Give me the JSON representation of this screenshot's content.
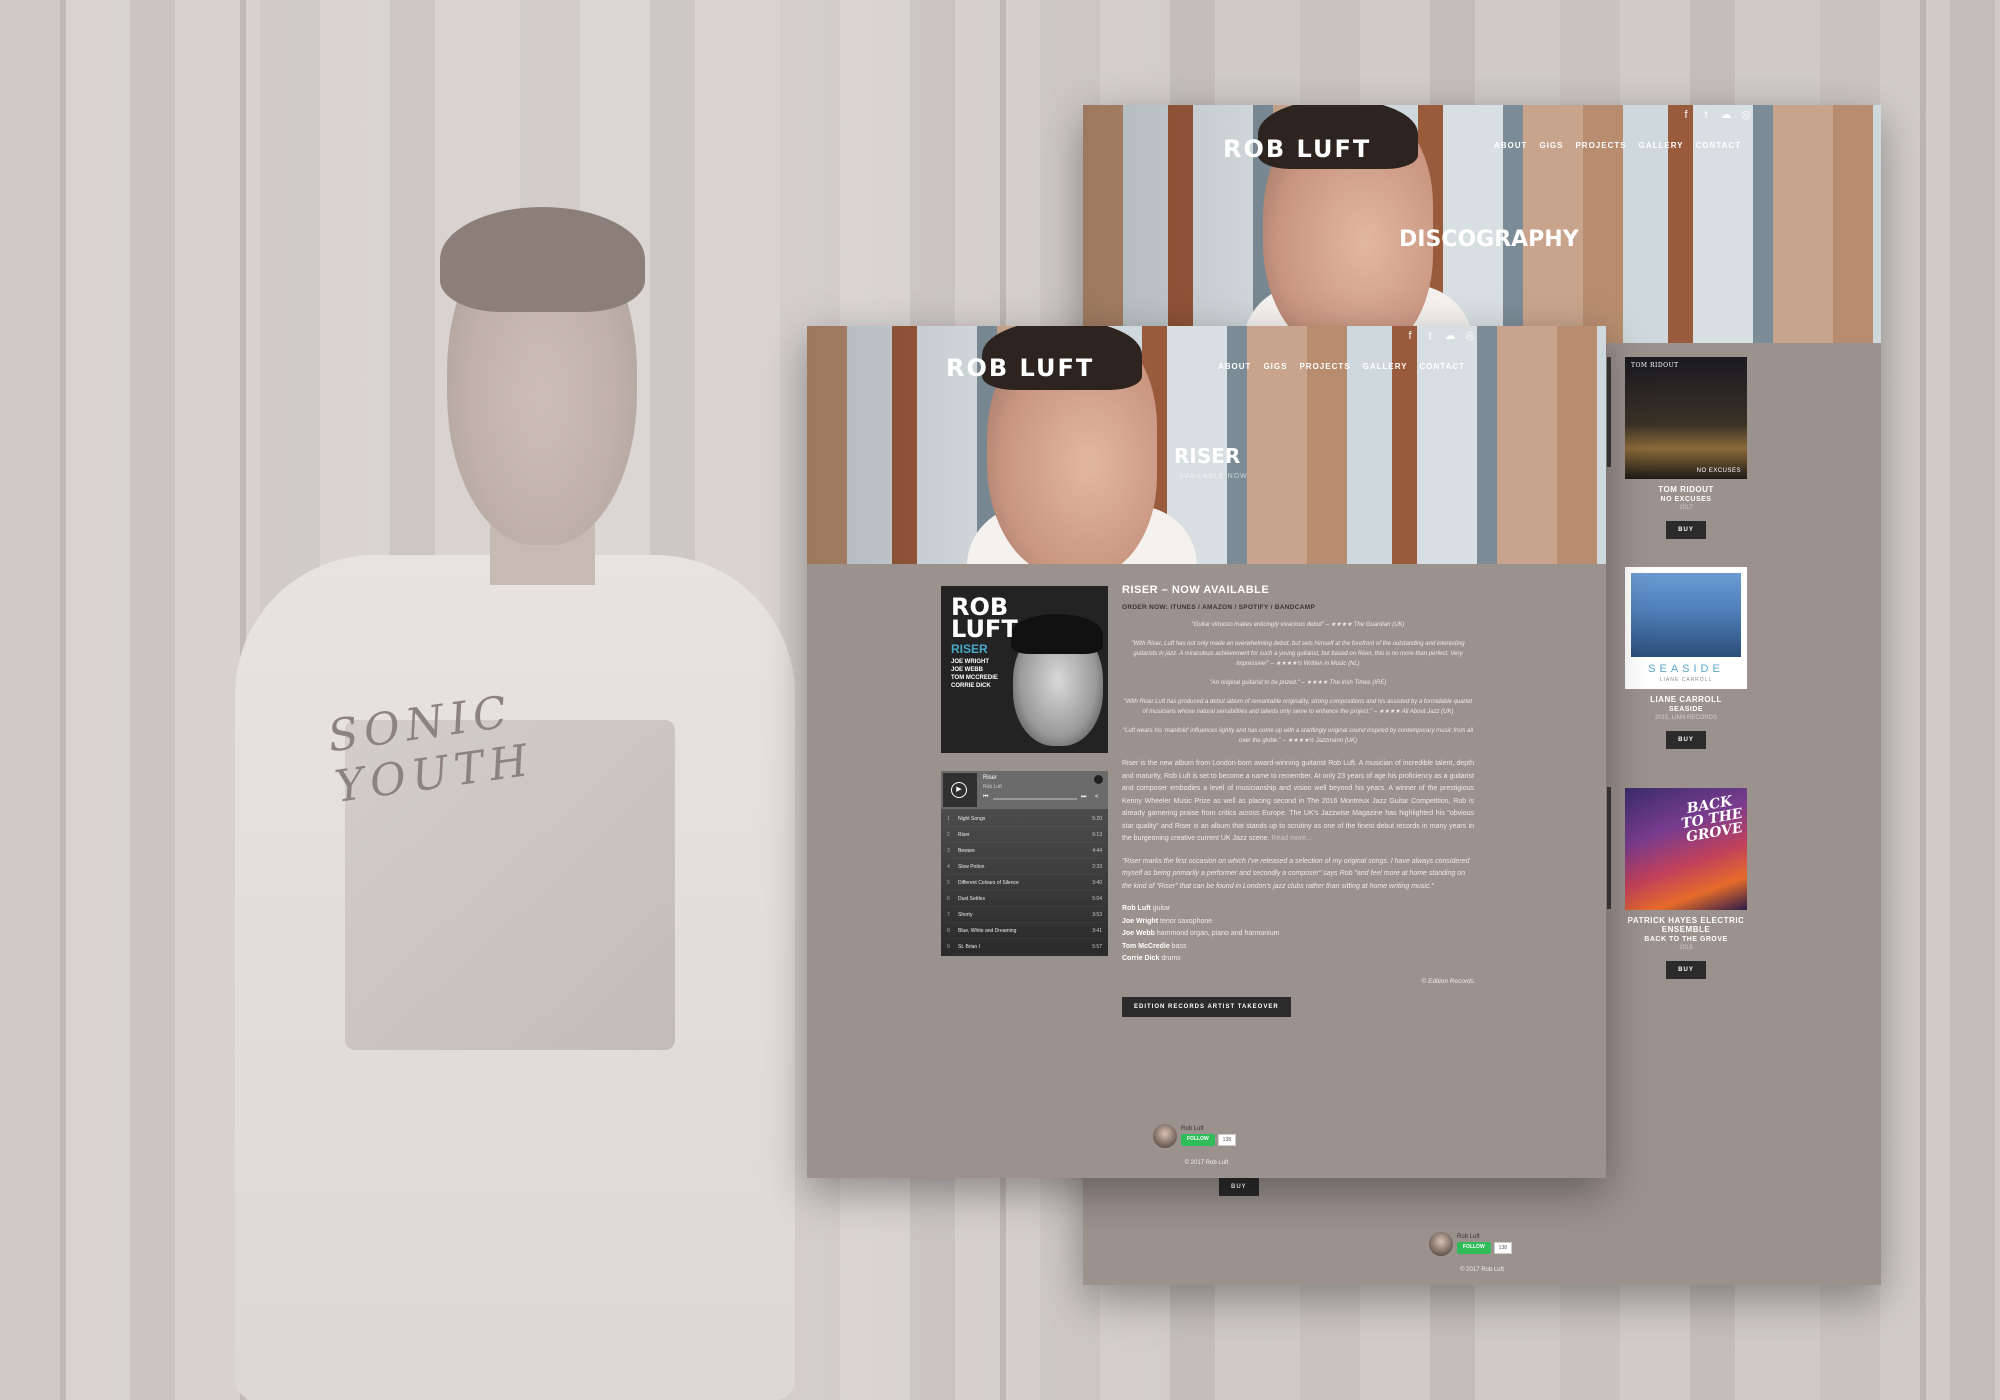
{
  "back_window": {
    "logo": "ROB LUFT",
    "nav": [
      "ABOUT",
      "GIGS",
      "PROJECTS",
      "GALLERY",
      "CONTACT"
    ],
    "social_icons": [
      "facebook-icon",
      "twitter-icon",
      "soundcloud-icon",
      "instagram-icon"
    ],
    "hero_title": "DISCOGRAPHY",
    "discs": [
      {
        "cover_text_top": "TOM RIDOUT",
        "cover_text_bottom": "NO EXCUSES",
        "artist": "TOM RIDOUT",
        "album": "NO EXCUSES",
        "meta": "2017",
        "buy": "BUY"
      },
      {
        "cover_text_top": "SEASIDE",
        "cover_text_bottom": "LIANE CARROLL",
        "artist": "LIANE CARROLL",
        "album": "SEASIDE",
        "meta": "2015, LINN RECORDS",
        "buy": "BUY"
      },
      {
        "cover_text_top": "BACK TO THE GROVE",
        "cover_text_bottom": "",
        "artist": "PATRICK HAYES ELECTRIC ENSEMBLE",
        "album": "BACK TO THE GROVE",
        "meta": "2015",
        "buy": "BUY"
      }
    ],
    "lower_buy": "BUY",
    "follow": {
      "name": "Rob Luft",
      "button": "FOLLOW",
      "count": "138"
    },
    "copyright": "© 2017 Rob Luft"
  },
  "front_window": {
    "logo": "ROB LUFT",
    "nav": [
      "ABOUT",
      "GIGS",
      "PROJECTS",
      "GALLERY",
      "CONTACT"
    ],
    "social_icons": [
      "facebook-icon",
      "twitter-icon",
      "soundcloud-icon",
      "instagram-icon"
    ],
    "hero_title": "RISER",
    "hero_sub": "AVAILABLE NOW",
    "album_art": {
      "title": "ROB\nLUFT",
      "album": "RISER",
      "names": "JOE WRIGHT\nJOE WEBB\nTOM MCCREDIE\nCORRIE DICK"
    },
    "player": {
      "title": "Riser",
      "artist": "Rob Luft",
      "tracks": [
        {
          "n": "1",
          "t": "Night Songs",
          "d": "5:20"
        },
        {
          "n": "2",
          "t": "Riser",
          "d": "6:13"
        },
        {
          "n": "3",
          "t": "Beware",
          "d": "4:44"
        },
        {
          "n": "4",
          "t": "Slow Potion",
          "d": "2:33"
        },
        {
          "n": "5",
          "t": "Different Colours of Silence",
          "d": "3:40"
        },
        {
          "n": "6",
          "t": "Dust Settles",
          "d": "5:04"
        },
        {
          "n": "7",
          "t": "Shorty",
          "d": "3:53"
        },
        {
          "n": "8",
          "t": "Blue, White and Dreaming",
          "d": "3:41"
        },
        {
          "n": "9",
          "t": "St. Brian I",
          "d": "5:57"
        }
      ]
    },
    "heading": "RISER – NOW AVAILABLE",
    "order": "ORDER NOW: ITUNES / AMAZON / SPOTIFY / BANDCAMP",
    "quotes": [
      "\"Guitar virtuoso makes enticingly vivacious debut\" – ★★★★ The Guardian (UK)",
      "\"With Riser, Luft has not only made an overwhelming debut, but sets himself at the forefront of the outstanding and interesting guitarists in jazz. A miraculous achievement for such a young guitarist, but based on Riser, this is no more than perfect. Very impressive!\" – ★★★★½ Written in Music (NL)",
      "\"An original guitarist to be prized.\" – ★★★★ The Irish Times (IRE)",
      "\"With Riser Luft has produced a debut album of remarkable originality, strong compositions and his assisted by a formidable quartet of musicians whose natural sensibilities and talents only serve to enhance the project.\" – ★★★★ All About Jazz (UK)",
      "\"Luft wears his 'manifold' influences lightly and has come up with a startlingly original sound inspired by contemporary music from all over the globe.\" – ★★★★½ Jazzmann (UK)"
    ],
    "paragraph": "Riser is the new album from London-born award-winning guitarist Rob Luft. A musician of incredible talent, depth and maturity, Rob Luft is set to become a name to remember. At only 23 years of age his proficiency as a guitarist and composer embodies a level of musicianship and vision well beyond his years. A winner of the prestigious Kenny Wheeler Music Prize as well as placing second in The 2016 Montreux Jazz Guitar Competition, Rob is already garnering praise from critics across Europe. The UK's Jazzwise Magazine has highlighted his \"obvious star quality\" and Riser is an album that stands up to scrutiny as one of the finest debut records in many years in the burgeoning creative current UK Jazz scene.",
    "read_more": "Read more...",
    "artist_quote": "\"Riser marks the first occasion on which I've released a selection of my original songs. I have always considered myself as being primarily a performer and secondly a composer\" says Rob \"and feel more at home standing on the kind of \"Riser\" that can be found in London's jazz clubs rather than sitting at home writing music.\"",
    "lineup": [
      {
        "name": "Rob Luft",
        "role": "guitar"
      },
      {
        "name": "Joe Wright",
        "role": "tenor saxophone"
      },
      {
        "name": "Joe Webb",
        "role": "hammond organ, piano and harmonium"
      },
      {
        "name": "Tom McCredie",
        "role": "bass"
      },
      {
        "name": "Corrie Dick",
        "role": "drums"
      }
    ],
    "credit": "© Edition Records",
    "takeover_button": "EDITION RECORDS ARTIST TAKEOVER",
    "follow": {
      "name": "Rob Luft",
      "button": "FOLLOW",
      "count": "138"
    },
    "copyright": "© 2017 Rob Luft"
  },
  "background": {
    "shirt_print": "SONIC YOUTH"
  }
}
